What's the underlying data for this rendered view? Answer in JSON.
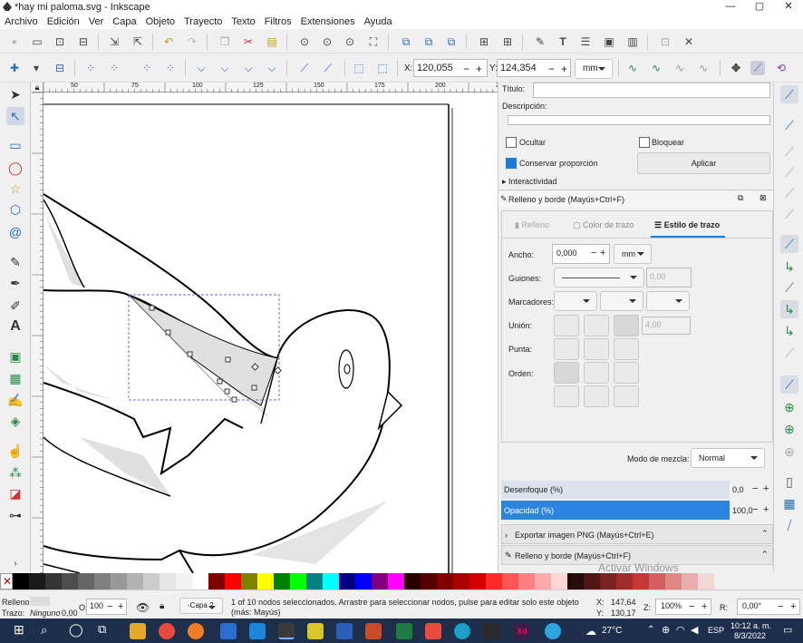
{
  "window": {
    "title": "*hay mi paloma.svg - Inkscape",
    "min": "—",
    "max": "▢",
    "close": "✕"
  },
  "menu": [
    "Archivo",
    "Edición",
    "Ver",
    "Capa",
    "Objeto",
    "Trayecto",
    "Texto",
    "Filtros",
    "Extensiones",
    "Ayuda"
  ],
  "nodebar": {
    "x_label": "X:",
    "x_value": "120,055",
    "y_label": "Y:",
    "y_value": "124,354",
    "unit": "mm"
  },
  "ruler": {
    "ticks": [
      "50",
      "75",
      "100",
      "125",
      "150",
      "175",
      "200",
      "225"
    ]
  },
  "object_props": {
    "title_label": "Título:",
    "desc_label": "Descripción:",
    "hide_label": "Ocultar",
    "lock_label": "Bloquear",
    "ratio_label": "Conservar proporción",
    "apply_label": "Aplicar",
    "interactivity_label": "Interactividad"
  },
  "fill_stroke": {
    "header": "Relleno y borde (Mayús+Ctrl+F)",
    "tabs": [
      "Relleno",
      "Color de trazo",
      "Estilo de trazo"
    ],
    "width_label": "Ancho:",
    "width_value": "0,000",
    "width_unit": "mm",
    "dashes_label": "Guiones:",
    "dashes_value": "0,00",
    "markers_label": "Marcadores:",
    "join_label": "Unión:",
    "join_value": "4,00",
    "cap_label": "Punta:",
    "order_label": "Orden:",
    "blend_label": "Modo de mezcla:",
    "blend_value": "Normal",
    "blur_label": "Desenfoque (%)",
    "blur_value": "0,0",
    "opacity_label": "Opacidad (%)",
    "opacity_value": "100,0",
    "opacity_fraction": 1.0
  },
  "docked": {
    "export_label": "Exportar imagen PNG (Mayús+Ctrl+E)",
    "fill_label": "Relleno y borde (Mayús+Ctrl+F)",
    "watermark1": "Activar Windows",
    "watermark2": "Ve a Configuración para activar Windows."
  },
  "status": {
    "fill_label": "Relleno:",
    "stroke_label": "Trazo:",
    "stroke_value": "Ninguno",
    "stroke_width": "0,00",
    "opacity_label": "O:",
    "opacity_value": "100",
    "layer": "-Capa 2",
    "message": "1 of 10 nodos seleccionados. Arrastre para seleccionar nodos, pulse para editar solo este objeto (más: Mayús)",
    "cursor_x_label": "X:",
    "cursor_x": "147,64",
    "cursor_y_label": "Y:",
    "cursor_y": "130,17",
    "zoom_label": "Z:",
    "zoom": "100%",
    "rot_label": "R:",
    "rotation": "0,00°"
  },
  "palette_colors": [
    "#000000",
    "#1a1a1a",
    "#333333",
    "#4d4d4d",
    "#666666",
    "#808080",
    "#999999",
    "#b3b3b3",
    "#cccccc",
    "#e6e6e6",
    "#f2f2f2",
    "#ffffff",
    "#800000",
    "#ff0000",
    "#808000",
    "#ffff00",
    "#008000",
    "#00ff00",
    "#008080",
    "#00ffff",
    "#000080",
    "#0000ff",
    "#800080",
    "#ff00ff",
    "#2b0000",
    "#550000",
    "#800000",
    "#aa0000",
    "#d40000",
    "#ff2a2a",
    "#ff5555",
    "#ff8080",
    "#ffaaaa",
    "#ffd5d5",
    "#280b0b",
    "#501616",
    "#782121",
    "#a02c2c",
    "#c83737",
    "#d35f5f",
    "#de8787",
    "#e9afaf",
    "#f4d7d7"
  ],
  "taskbar": {
    "weather": "27°C",
    "lang": "ESP",
    "time": "10:12 a. m.",
    "date": "8/3/2022"
  }
}
